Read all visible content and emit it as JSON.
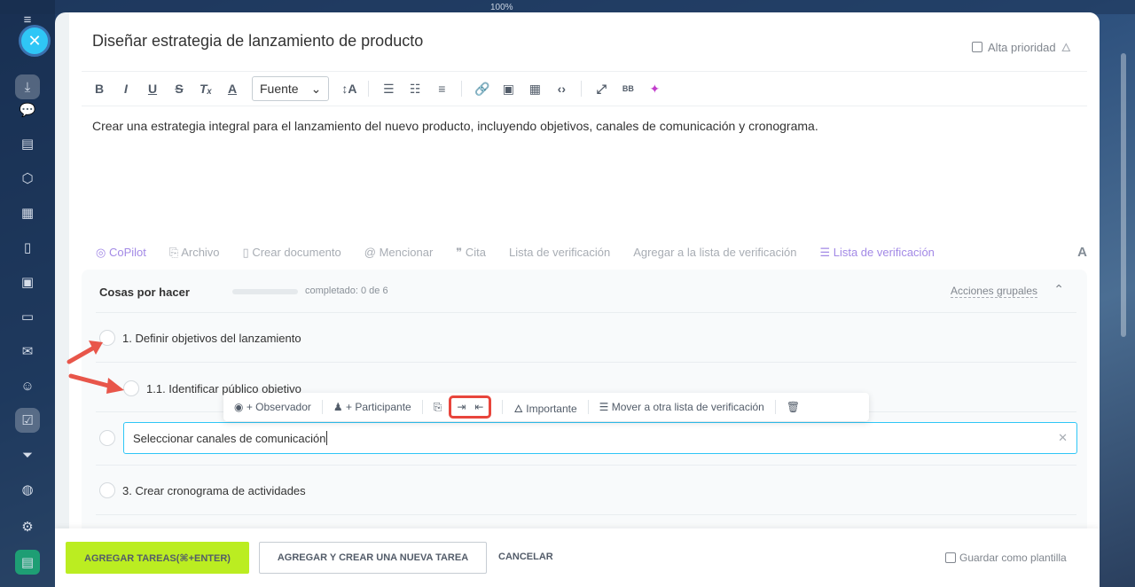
{
  "browser": {
    "zoom": "100%"
  },
  "task": {
    "title": "Diseñar estrategia de lanzamiento de producto",
    "high_priority_label": "Alta prioridad",
    "description": "Crear una estrategia integral para el lanzamiento del nuevo producto, incluyendo objetivos, canales de comunicación y cronograma."
  },
  "editor": {
    "font_select": "Fuente"
  },
  "tools": {
    "copilot": "CoPilot",
    "file": "Archivo",
    "create_doc": "Crear documento",
    "mention": "Mencionar",
    "quote": "Cita",
    "checklist": "Lista de verificación",
    "add_to_checklist": "Agregar a la lista de verificación",
    "checklist_active": "Lista de verificación",
    "font_toggle": "A"
  },
  "checklist": {
    "title": "Cosas por hacer",
    "completed": "completado: 0 de 6",
    "progress": 0,
    "group_actions": "Acciones grupales",
    "items": [
      {
        "label": "1. Definir objetivos del lanzamiento"
      },
      {
        "label": "1.1. Identificar público objetivo"
      },
      {
        "label": "3. Crear cronograma de actividades"
      }
    ],
    "editing_value": "Seleccionar canales de comunicación"
  },
  "item_toolbar": {
    "observer": "+ Observador",
    "participant": "+ Participante",
    "important": "Importante",
    "move": "Mover a otra lista de verificación"
  },
  "footer": {
    "add_tasks": "AGREGAR TAREAS(⌘+ENTER)",
    "add_and_create": "AGREGAR Y CREAR UNA NUEVA TAREA",
    "cancel": "CANCELAR",
    "save_template": "Guardar como plantilla"
  },
  "colors": {
    "accent_blue": "#2fc6f6",
    "primary_green": "#bbed21",
    "highlight_red": "#e8453c",
    "copilot_purple": "#a38ae6"
  }
}
